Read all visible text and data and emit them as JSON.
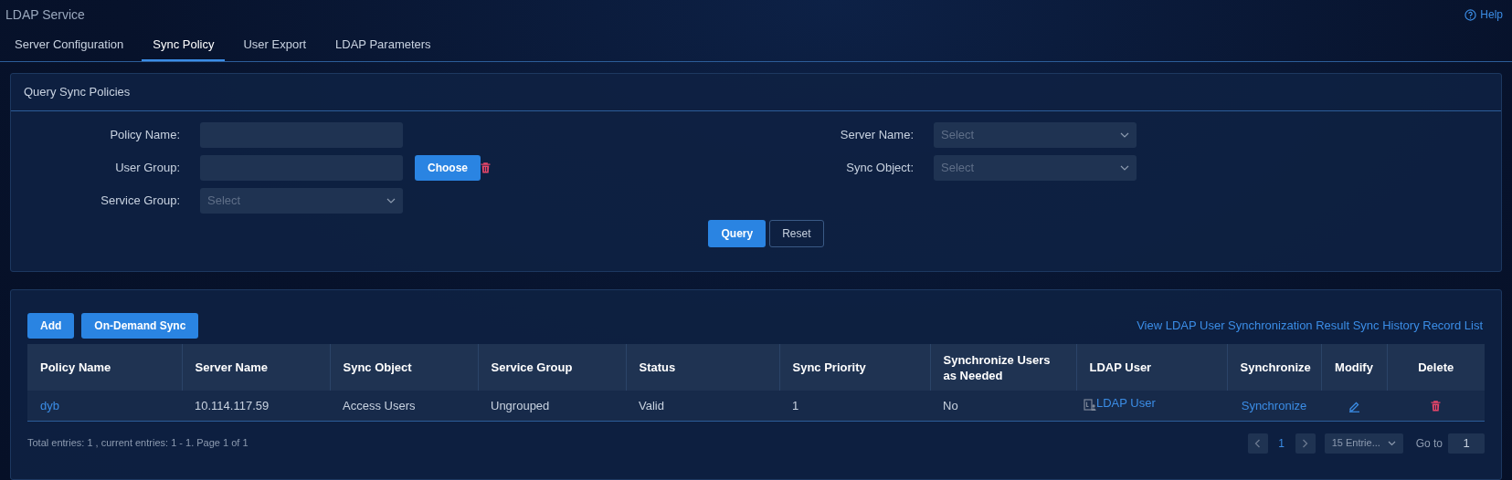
{
  "window": {
    "title": "LDAP Service",
    "help": "Help"
  },
  "tabs": [
    {
      "label": "Server Configuration",
      "selected": false
    },
    {
      "label": "Sync Policy",
      "selected": true
    },
    {
      "label": "User Export",
      "selected": false
    },
    {
      "label": "LDAP Parameters",
      "selected": false
    }
  ],
  "query_panel": {
    "title": "Query Sync Policies",
    "left_fields": [
      {
        "label": "Policy Name:",
        "kind": "text"
      },
      {
        "label": "User Group:",
        "kind": "picker",
        "button": "Choose"
      },
      {
        "label": "Service Group:",
        "kind": "select",
        "placeholder": "Select"
      }
    ],
    "right_fields": [
      {
        "label": "Server Name:",
        "kind": "select",
        "placeholder": "Select"
      },
      {
        "label": "Sync Object:",
        "kind": "select",
        "placeholder": "Select"
      }
    ],
    "buttons": [
      {
        "label": "Query",
        "kind": "primary"
      },
      {
        "label": "Reset",
        "kind": "outline"
      }
    ]
  },
  "table_panel": {
    "buttons": [
      "Add",
      "On-Demand Sync"
    ],
    "link": "View LDAP User Synchronization Result Sync History Record List",
    "columns": [
      "Policy Name",
      "Server Name",
      "Sync Object",
      "Service Group",
      "Status",
      "Sync Priority",
      "Synchronize Users as Needed",
      "LDAP User",
      "Synchronize",
      "Modify",
      "Delete"
    ],
    "rows": [
      [
        {
          "kind": "link",
          "text": "dyb"
        },
        {
          "kind": "text",
          "text": "10.114.117.59"
        },
        {
          "kind": "text",
          "text": "Access Users"
        },
        {
          "kind": "text",
          "text": "Ungrouped"
        },
        {
          "kind": "text",
          "text": "Valid"
        },
        {
          "kind": "text",
          "text": "1"
        },
        {
          "kind": "text",
          "text": "No"
        },
        {
          "kind": "icon-link",
          "text": "LDAP User"
        },
        {
          "kind": "link",
          "text": "Synchronize"
        },
        {
          "kind": "edit"
        },
        {
          "kind": "delete"
        }
      ]
    ],
    "summary": "Total entries: 1 , current entries: 1 - 1. Page 1 of 1",
    "pages": [
      {
        "label": "1",
        "selected": true
      }
    ],
    "page_size": "15 Entrie...",
    "goto_label": "Go to",
    "goto_value": "1"
  }
}
